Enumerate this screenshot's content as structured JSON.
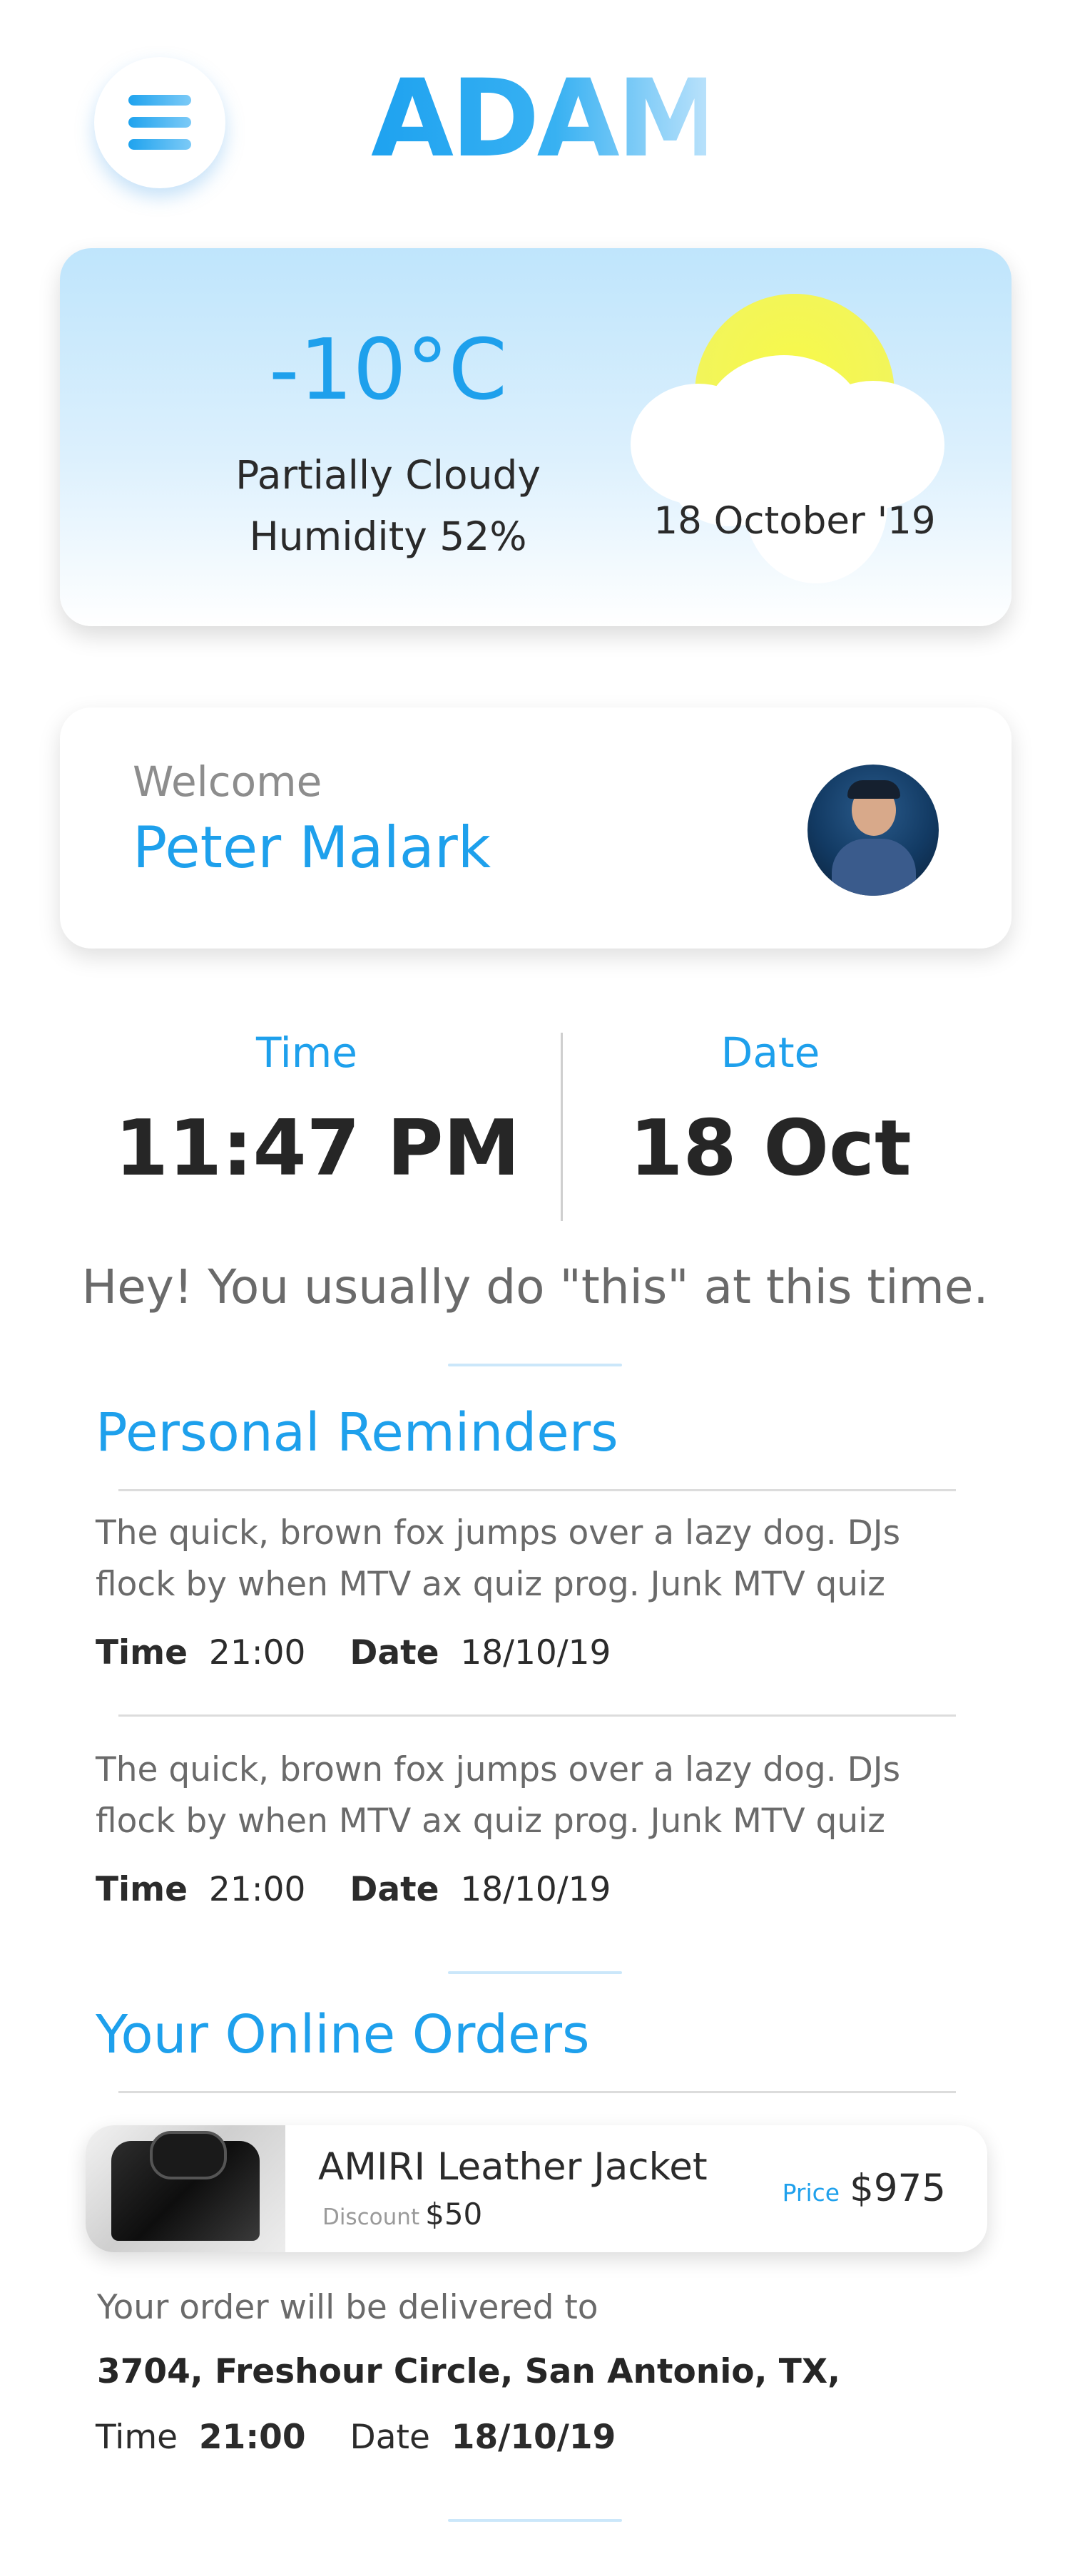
{
  "header": {
    "menu_icon": "hamburger-menu-icon",
    "logo": "ADAM"
  },
  "weather": {
    "temperature": "-10°C",
    "condition": "Partially Cloudy",
    "humidity": "Humidity 52%",
    "date": "18 October '19",
    "icon": "partly-cloudy-icon"
  },
  "welcome": {
    "label": "Welcome",
    "name": "Peter Malark",
    "avatar_icon": "user-avatar"
  },
  "clock": {
    "time_label": "Time",
    "time_value": "11:47 PM",
    "date_label": "Date",
    "date_value": "18 Oct"
  },
  "suggestion": "Hey! You usually do \"this\" at this time.",
  "reminders": {
    "title": "Personal Reminders",
    "items": [
      {
        "text": "The quick, brown fox jumps over a lazy dog. DJs flock by when MTV ax quiz prog. Junk MTV quiz",
        "time_label": "Time",
        "time": "21:00",
        "date_label": "Date",
        "date": "18/10/19"
      },
      {
        "text": "The quick, brown fox jumps over a lazy dog. DJs flock by when MTV ax quiz prog. Junk MTV quiz",
        "time_label": "Time",
        "time": "21:00",
        "date_label": "Date",
        "date": "18/10/19"
      }
    ]
  },
  "orders": {
    "title": "Your Online Orders",
    "item": {
      "name": "AMIRI Leather Jacket",
      "discount_label": "Discount",
      "discount": "$50",
      "price_label": "Price",
      "price": "$975",
      "image": "leather-jacket-image"
    },
    "delivery_label": "Your order will be delivered to",
    "address": "3704, Freshour Circle, San Antonio, TX,",
    "time_label": "Time",
    "time": "21:00",
    "date_label": "Date",
    "date": "18/10/19"
  },
  "colors": {
    "accent": "#1ea0ec",
    "weather_gradient_top": "#bfe5fc",
    "sun": "#f2f55a"
  }
}
